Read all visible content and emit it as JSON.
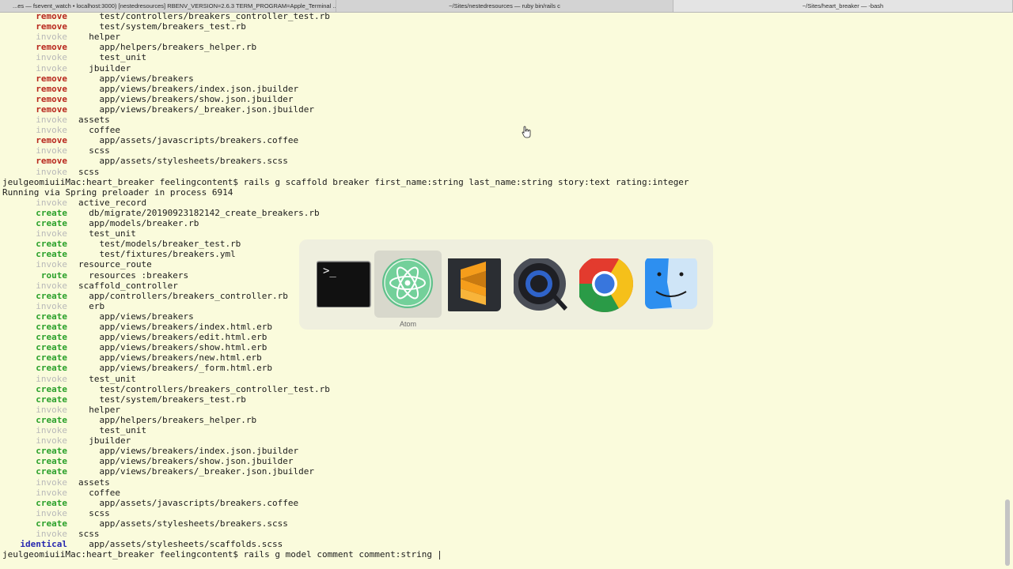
{
  "tabs": [
    "...es — fsevent_watch • localhost:3000) [nestedresources] RBENV_VERSION=2.6.3 TERM_PROGRAM=Apple_Terminal ...",
    "~/Sites/nestedresources — ruby bin/rails c",
    "~/Sites/heart_breaker — -bash"
  ],
  "terminal_lines": [
    {
      "verb": "remove",
      "indent": "    ",
      "text": "test/controllers/breakers_controller_test.rb"
    },
    {
      "verb": "remove",
      "indent": "    ",
      "text": "test/system/breakers_test.rb"
    },
    {
      "verb": "invoke",
      "indent": "  ",
      "text": "helper"
    },
    {
      "verb": "remove",
      "indent": "    ",
      "text": "app/helpers/breakers_helper.rb"
    },
    {
      "verb": "invoke",
      "indent": "    ",
      "text": "test_unit"
    },
    {
      "verb": "invoke",
      "indent": "  ",
      "text": "jbuilder"
    },
    {
      "verb": "remove",
      "indent": "    ",
      "text": "app/views/breakers"
    },
    {
      "verb": "remove",
      "indent": "    ",
      "text": "app/views/breakers/index.json.jbuilder"
    },
    {
      "verb": "remove",
      "indent": "    ",
      "text": "app/views/breakers/show.json.jbuilder"
    },
    {
      "verb": "remove",
      "indent": "    ",
      "text": "app/views/breakers/_breaker.json.jbuilder"
    },
    {
      "verb": "invoke",
      "indent": "",
      "text": "assets"
    },
    {
      "verb": "invoke",
      "indent": "  ",
      "text": "coffee"
    },
    {
      "verb": "remove",
      "indent": "    ",
      "text": "app/assets/javascripts/breakers.coffee"
    },
    {
      "verb": "invoke",
      "indent": "  ",
      "text": "scss"
    },
    {
      "verb": "remove",
      "indent": "    ",
      "text": "app/assets/stylesheets/breakers.scss"
    },
    {
      "verb": "invoke",
      "indent": "",
      "text": "scss"
    },
    {
      "plain": "jeulgeomiuiiMac:heart_breaker feelingcontent$ rails g scaffold breaker first_name:string last_name:string story:text rating:integer"
    },
    {
      "plain": "Running via Spring preloader in process 6914"
    },
    {
      "verb": "invoke",
      "indent": "",
      "text": "active_record"
    },
    {
      "verb": "create",
      "indent": "  ",
      "text": "db/migrate/20190923182142_create_breakers.rb"
    },
    {
      "verb": "create",
      "indent": "  ",
      "text": "app/models/breaker.rb"
    },
    {
      "verb": "invoke",
      "indent": "  ",
      "text": "test_unit"
    },
    {
      "verb": "create",
      "indent": "    ",
      "text": "test/models/breaker_test.rb"
    },
    {
      "verb": "create",
      "indent": "    ",
      "text": "test/fixtures/breakers.yml"
    },
    {
      "verb": "invoke",
      "indent": "",
      "text": "resource_route"
    },
    {
      "verb": "route",
      "indent": "  ",
      "text": "resources :breakers"
    },
    {
      "verb": "invoke",
      "indent": "",
      "text": "scaffold_controller"
    },
    {
      "verb": "create",
      "indent": "  ",
      "text": "app/controllers/breakers_controller.rb"
    },
    {
      "verb": "invoke",
      "indent": "  ",
      "text": "erb"
    },
    {
      "verb": "create",
      "indent": "    ",
      "text": "app/views/breakers"
    },
    {
      "verb": "create",
      "indent": "    ",
      "text": "app/views/breakers/index.html.erb"
    },
    {
      "verb": "create",
      "indent": "    ",
      "text": "app/views/breakers/edit.html.erb"
    },
    {
      "verb": "create",
      "indent": "    ",
      "text": "app/views/breakers/show.html.erb"
    },
    {
      "verb": "create",
      "indent": "    ",
      "text": "app/views/breakers/new.html.erb"
    },
    {
      "verb": "create",
      "indent": "    ",
      "text": "app/views/breakers/_form.html.erb"
    },
    {
      "verb": "invoke",
      "indent": "  ",
      "text": "test_unit"
    },
    {
      "verb": "create",
      "indent": "    ",
      "text": "test/controllers/breakers_controller_test.rb"
    },
    {
      "verb": "create",
      "indent": "    ",
      "text": "test/system/breakers_test.rb"
    },
    {
      "verb": "invoke",
      "indent": "  ",
      "text": "helper"
    },
    {
      "verb": "create",
      "indent": "    ",
      "text": "app/helpers/breakers_helper.rb"
    },
    {
      "verb": "invoke",
      "indent": "    ",
      "text": "test_unit"
    },
    {
      "verb": "invoke",
      "indent": "  ",
      "text": "jbuilder"
    },
    {
      "verb": "create",
      "indent": "    ",
      "text": "app/views/breakers/index.json.jbuilder"
    },
    {
      "verb": "create",
      "indent": "    ",
      "text": "app/views/breakers/show.json.jbuilder"
    },
    {
      "verb": "create",
      "indent": "    ",
      "text": "app/views/breakers/_breaker.json.jbuilder"
    },
    {
      "verb": "invoke",
      "indent": "",
      "text": "assets"
    },
    {
      "verb": "invoke",
      "indent": "  ",
      "text": "coffee"
    },
    {
      "verb": "create",
      "indent": "    ",
      "text": "app/assets/javascripts/breakers.coffee"
    },
    {
      "verb": "invoke",
      "indent": "  ",
      "text": "scss"
    },
    {
      "verb": "create",
      "indent": "    ",
      "text": "app/assets/stylesheets/breakers.scss"
    },
    {
      "verb": "invoke",
      "indent": "",
      "text": "scss"
    },
    {
      "verb": "identical",
      "indent": "  ",
      "text": "app/assets/stylesheets/scaffolds.scss"
    },
    {
      "plain": "jeulgeomiuiiMac:heart_breaker feelingcontent$ rails g model comment comment:string ",
      "cursor": true
    }
  ],
  "app_switcher": {
    "apps": [
      {
        "name": "Terminal",
        "icon": "terminal-icon"
      },
      {
        "name": "Atom",
        "icon": "atom-icon",
        "selected": true
      },
      {
        "name": "Sublime Text",
        "icon": "sublime-text-icon"
      },
      {
        "name": "QuickTime Player",
        "icon": "quicktime-icon"
      },
      {
        "name": "Google Chrome",
        "icon": "chrome-icon"
      },
      {
        "name": "Finder",
        "icon": "finder-icon"
      }
    ],
    "selected_label": "Atom"
  },
  "colors": {
    "background": "#fafbdc",
    "remove": "#b8281e",
    "create": "#2aa02a",
    "invoke": "#b9b9b9",
    "identical": "#2828b0"
  }
}
